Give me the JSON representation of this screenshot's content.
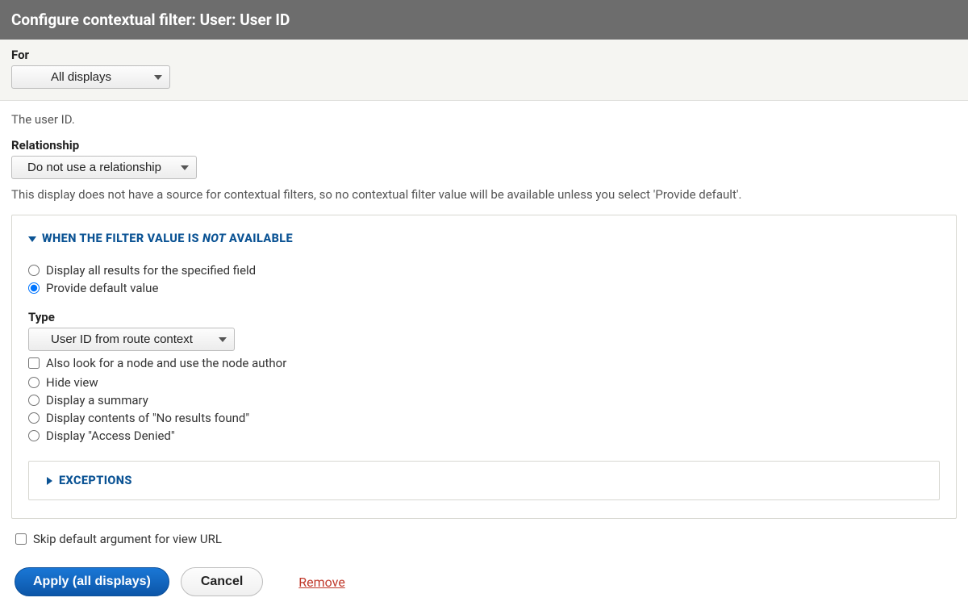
{
  "header": {
    "title": "Configure contextual filter: User: User ID"
  },
  "for": {
    "label": "For",
    "selected": "All displays"
  },
  "description": "The user ID.",
  "relationship": {
    "label": "Relationship",
    "selected": "Do not use a relationship"
  },
  "source_hint": "This display does not have a source for contextual filters, so no contextual filter value will be available unless you select 'Provide default'.",
  "not_available": {
    "title_pre": "WHEN THE FILTER VALUE IS ",
    "title_not": "NOT",
    "title_post": " AVAILABLE",
    "options": {
      "display_all": "Display all results for the specified field",
      "provide_default": "Provide default value",
      "type_label": "Type",
      "type_selected": "User ID from route context",
      "also_look_node": "Also look for a node and use the node author",
      "hide_view": "Hide view",
      "display_summary": "Display a summary",
      "display_no_results": "Display contents of \"No results found\"",
      "display_access_denied": "Display \"Access Denied\""
    },
    "exceptions_title": "EXCEPTIONS"
  },
  "skip_default": "Skip default argument for view URL",
  "actions": {
    "apply": "Apply (all displays)",
    "cancel": "Cancel",
    "remove": "Remove"
  }
}
